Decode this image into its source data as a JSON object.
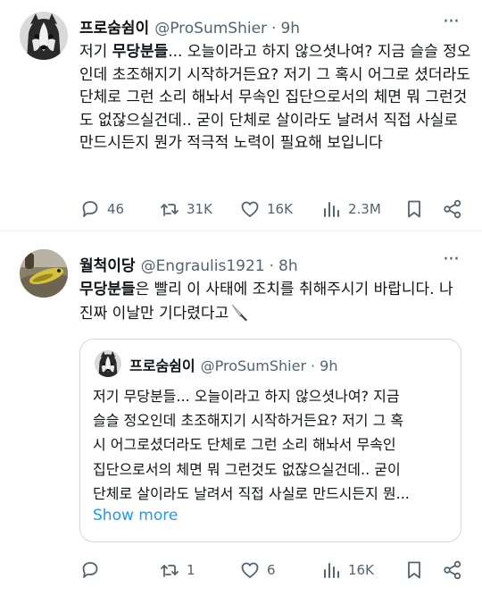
{
  "tweets": [
    {
      "name": "프로숨쉼이",
      "handle": "@ProSumShier",
      "separator": "·",
      "time": "9h",
      "body_pre": "저기 ",
      "body_bold": "무당분들",
      "body_post": "... 오늘이라고 하지 않으셧나여? 지금 슬슬 정오인데 초조해지기 시작하거든요? 저기 그 혹시 어그로 셨더라도 단체로 그런 소리 해놔서 무속인 집단으로서의 체면 뭐 그런것도 없잖으실건데.. 굳이 단체로 살이라도 날려서 직접 사실로 만드시든지 뭔가 적극적 노력이 필요해 보입니다",
      "replies": "46",
      "reposts": "31K",
      "likes": "16K",
      "views": "2.3M"
    },
    {
      "name": "월척이당",
      "handle": "@Engraulis1921",
      "separator": "·",
      "time": "8h",
      "body_bold": "무당분들",
      "body_post": "은 빨리 이 사태에 조치를 취해주시기 바랍니다. 나 진짜 이날만 기다렸다고",
      "replies": "",
      "reposts": "1",
      "likes": "6",
      "views": "16K",
      "quote": {
        "name": "프로숨쉼이",
        "handle": "@ProSumShier",
        "separator": "·",
        "time": "9h",
        "lines": [
          "저기 무당분들... 오늘이라고 하지 않으셧나여? 지금",
          "슬슬 정오인데 초조해지기 시작하거든요? 저기 그 혹",
          "시 어그로셨더라도 단체로 그런 소리 해놔서 무속인",
          "집단으로서의 체면 뭐 그런것도 없잖으실건데.. 굳이",
          "단체로 살이라도 날려서 직접 사실로 만드시든지 뭔..."
        ],
        "show_more": "Show more"
      }
    }
  ],
  "icons": {
    "reply": "speech-bubble-icon",
    "repost": "repost-arrows-icon",
    "like": "heart-icon",
    "views": "bar-chart-icon",
    "bookmark": "bookmark-icon",
    "share": "share-icon",
    "more": "more-dots-icon",
    "knife": "knife-emoji-icon"
  },
  "colors": {
    "text": "#0f1419",
    "secondary": "#536471",
    "link": "#1d9bf0",
    "border": "#cfd9de"
  }
}
